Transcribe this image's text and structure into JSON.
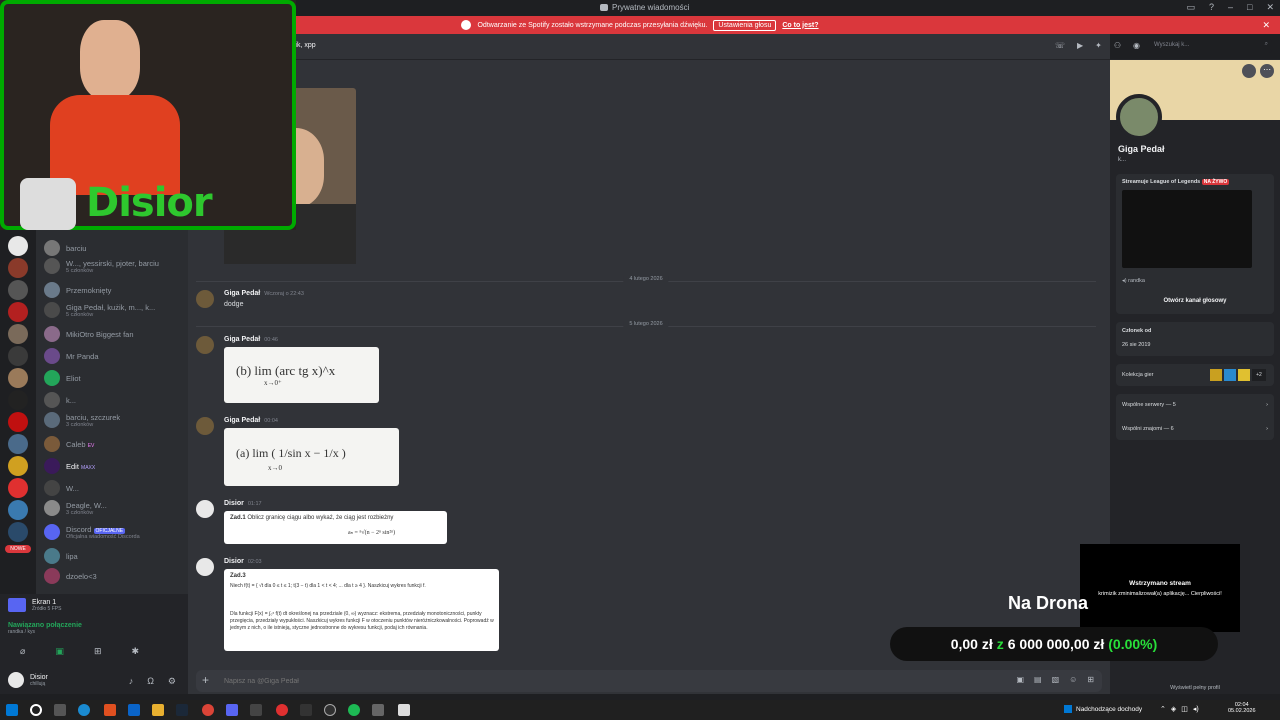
{
  "window": {
    "title": "Prywatne wiadomości"
  },
  "notice": {
    "text": "Odtwarzanie ze Spotify zostało wstrzymane podczas przesyłania dźwięku.",
    "button": "Ustawienia głosu",
    "link": "Co to jest?"
  },
  "chat_header": {
    "channel_name": "osik, xpp",
    "search_placeholder": "Wyszukaj k..."
  },
  "dm_list": [
    {
      "name": "barciu",
      "sub": ""
    },
    {
      "name": "W..., yessirski, pjoter, barciu",
      "sub": "5 członków"
    },
    {
      "name": "Przemoknięty",
      "sub": ""
    },
    {
      "name": "Giga Pedał, kużik, m..., k...",
      "sub": "5 członków"
    },
    {
      "name": "MikiOtro Biggest fan",
      "sub": ""
    },
    {
      "name": "Mr Panda",
      "sub": ""
    },
    {
      "name": "Eliot",
      "sub": ""
    },
    {
      "name": "k...",
      "sub": ""
    },
    {
      "name": "barciu, szczurek",
      "sub": "3 członków"
    },
    {
      "name": "Caleb",
      "sub": ""
    },
    {
      "name": "Edit",
      "sub": ""
    },
    {
      "name": "W...",
      "sub": ""
    },
    {
      "name": "Deagle, W...",
      "sub": "3 członków"
    },
    {
      "name": "Discord",
      "sub": "Oficjalna wiadomość Discorda"
    },
    {
      "name": "lipa",
      "sub": ""
    },
    {
      "name": "dzoelo<3",
      "sub": ""
    }
  ],
  "badges": {
    "caleb": "EV",
    "edit": "MAXX",
    "official": "OFICJALNE",
    "new": "NOWE"
  },
  "dividers": [
    "4 lutego 2026",
    "5 lutego 2026"
  ],
  "messages": [
    {
      "author": "Giga Pedał",
      "time": "Wczoraj o 22:43",
      "text": "dodge"
    },
    {
      "author": "Giga Pedał",
      "time": "00:46",
      "math": "(b)  lim (arc tg x)^x",
      "math_sub": "x→0⁺"
    },
    {
      "author": "Giga Pedał",
      "time": "00:04",
      "math": "(a)  lim ( 1/sin x − 1/x )",
      "math_sub": "x→0"
    },
    {
      "author": "Disior",
      "time": "01:17",
      "task_title": "Zad.1",
      "task_text": "Oblicz granicę ciągu albo wykaż, że ciąg jest rozbieżny",
      "task_formula": "aₙ = ⁿ√(n − 2ⁿ sin²ⁿ)"
    },
    {
      "author": "Disior",
      "time": "02:03",
      "task_title": "Zad.3",
      "task_text": "Niech f(t) = { √t dla 0 ≤ t ≤ 1; t(3 − t) dla 1 < t < 4; ... dla t ≥ 4 }. Naszkicuj wykres funkcji f.",
      "task_text2": "Dla funkcji F(x) = ∫₀ˣ f(t) dt określonej na przedziale (0, ∞) wyznacz: ekstrema, przedziały monotoniczności, punkty przegięcia, przedziały wypukłości. Naszkicuj wykres funkcji F w otoczeniu punktów nieróżniczkowalności. Poprowadź w jednym z nich, o ile istnieją, styczne jednostronne do wykresu funkcji, podaj ich równania."
    }
  ],
  "composer": {
    "placeholder": "Napisz na @Giga Pedał"
  },
  "profile": {
    "name": "Giga Pedał",
    "tag": "k...",
    "streaming_label": "Streamuje League of Legends",
    "live_badge": "NA ŻYWO",
    "voice_channel": "randka",
    "open_voice": "Otwórz kanał głosowy",
    "member_since_label": "Członek od",
    "member_since": "26 sie 2019",
    "collection_label": "Kolekcja gier",
    "collection_more": "+2",
    "mutual_servers": "Wspólne serwery — 5",
    "mutual_friends": "Wspólni znajomi — 6",
    "view_full": "Wyświetl pełny profil"
  },
  "user_panel": {
    "screen_title": "Ekran 1",
    "screen_sub": "Źródło 5 FPS",
    "connection": "Nawiązano połączenie",
    "connection_sub": "randka / kys",
    "username": "Disior",
    "status": "chillują"
  },
  "overlay": {
    "webcam_name": "Disior",
    "donation_title": "Na Drona",
    "donation_current": "0,00 zł",
    "donation_sep": "z",
    "donation_goal": "6 000 000,00 zł",
    "donation_percent": "(0.00%)",
    "paused_title": "Wstrzymano stream",
    "paused_text": "krimizik zminimalizował(a) aplikację... Cierpliwości!"
  },
  "taskbar": {
    "news": "Nadchodzące dochody",
    "time": "02:04",
    "date": "05.02.2026"
  },
  "colors": {
    "accent": "#5865f2",
    "danger": "#da373c",
    "green": "#23a55a",
    "donation_green": "#28e03a"
  }
}
